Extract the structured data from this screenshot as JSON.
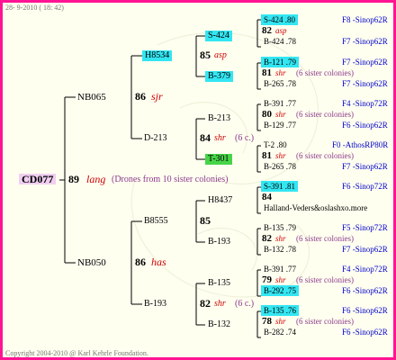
{
  "header": {
    "date": "28- 9-2010 ( 18: 42)"
  },
  "footer": {
    "copyright": "Copyright 2004-2010 @ Karl Kehrle Foundation."
  },
  "root": {
    "id": "CD077",
    "num": "89",
    "name": "lang",
    "note": "(Drones from 10 sister colonies)"
  },
  "gen1": [
    {
      "id": "NB065",
      "num": "86",
      "name": "sjr"
    },
    {
      "id": "NB050",
      "num": "86",
      "name": "has"
    }
  ],
  "gen2": [
    {
      "id": "H8534",
      "num": "85",
      "name": "asp"
    },
    {
      "id": "D-213",
      "num": "84",
      "name": "shr",
      "note": "(6 c.)"
    },
    {
      "id": "B8555",
      "num": "85"
    },
    {
      "id": "B-193",
      "num": "82",
      "name": "shr",
      "note": "(6 c.)"
    }
  ],
  "gen3": [
    "S-424",
    "B-379",
    "B-213",
    "T-301",
    "H8437",
    "B-193",
    "B-135",
    "B-132"
  ],
  "gen4": [
    {
      "l1": "S-424 .80",
      "l1h": "cyan",
      "num": "82",
      "name": "asp",
      "l2": "B-424 .78",
      "r1": "F8 -Sinop62R",
      "r2": "F7 -Sinop62R"
    },
    {
      "l1": "B-121 .79",
      "l1h": "cyan",
      "num": "81",
      "name": "shr",
      "note": "(6 sister colonies)",
      "l2": "B-265 .78",
      "r1": "F7 -Sinop62R",
      "r2": "F7 -Sinop62R"
    },
    {
      "l1": "B-391 .77",
      "num": "80",
      "name": "shr",
      "note": "(6 sister colonies)",
      "l2": "B-129 .77",
      "r1": "F4 -Sinop72R",
      "r2": "F6 -Sinop62R"
    },
    {
      "l1": "T-2 .80",
      "num": "81",
      "name": "shr",
      "note": "(6 sister colonies)",
      "l2": "B-265 .78",
      "r1": "F0 -AthosRP80R",
      "r2": "F7 -Sinop62R"
    },
    {
      "l1": "S-391 .81",
      "l1h": "cyan",
      "num": "84",
      "l2": "Halland-Veders&oslashxo.more",
      "r1": "F6 -Sinop72R",
      "r2": ""
    },
    {
      "l1": "B-135 .79",
      "num": "82",
      "name": "shr",
      "note": "(6 sister colonies)",
      "l2": "B-132 .78",
      "r1": "F5 -Sinop72R",
      "r2": "F7 -Sinop62R"
    },
    {
      "l1": "B-391 .77",
      "num": "79",
      "name": "shr",
      "note": "(6 sister colonies)",
      "l2": "B-292 .75",
      "l2h": "cyan",
      "r1": "F4 -Sinop72R",
      "r2": "F6 -Sinop62R"
    },
    {
      "l1": "B-135 .76",
      "l1h": "cyan",
      "num": "78",
      "name": "shr",
      "note": "(6 sister colonies)",
      "l2": "B-282 .74",
      "r1": "F6 -Sinop62R",
      "r2": "F6 -Sinop62R"
    }
  ]
}
